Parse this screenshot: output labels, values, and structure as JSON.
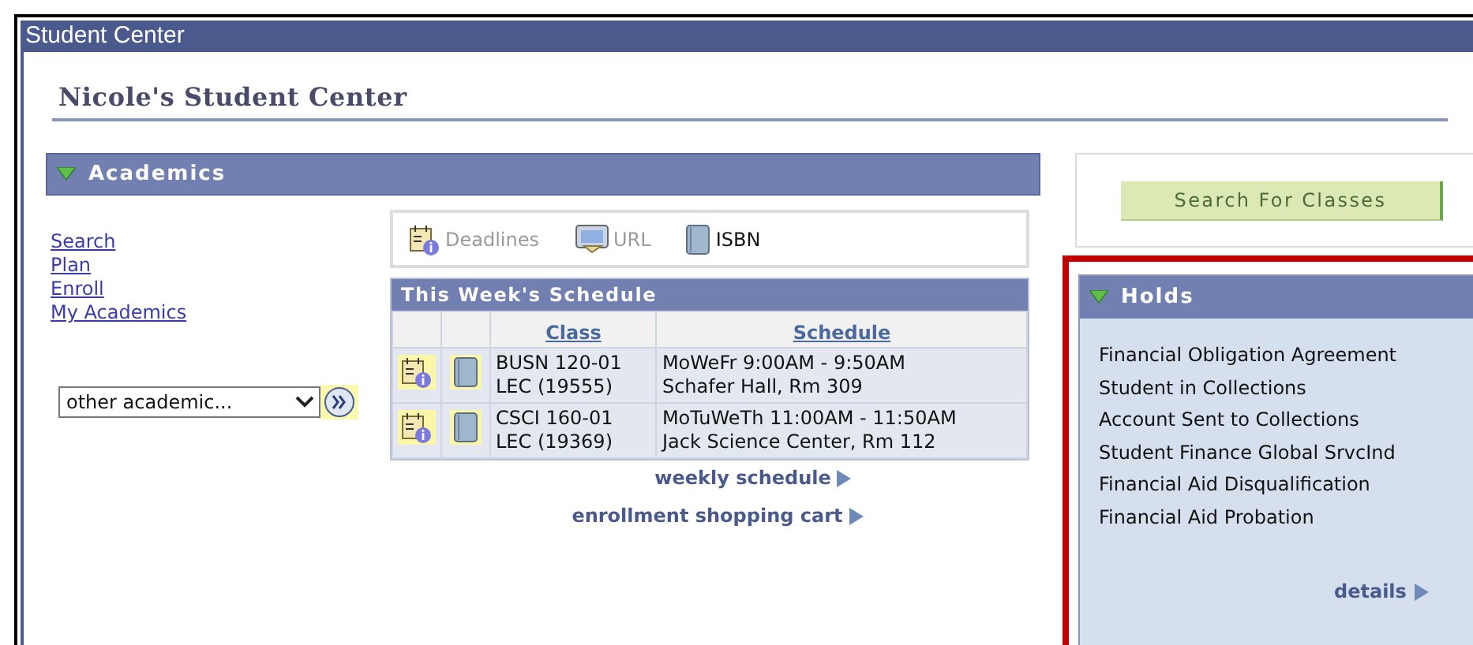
{
  "window": {
    "title": "Student Center"
  },
  "page_title": "Nicole's Student Center",
  "academics": {
    "title": "Academics",
    "expanded": true,
    "links": [
      "Search",
      "Plan",
      "Enroll",
      "My Academics"
    ],
    "dropdown": {
      "value": "other academic..."
    },
    "toolbar": [
      {
        "kind": "deadlines",
        "label": "Deadlines",
        "disabled": true
      },
      {
        "kind": "url",
        "label": "URL",
        "disabled": true
      },
      {
        "kind": "book",
        "label": "ISBN",
        "disabled": false
      }
    ],
    "schedule": {
      "title": "This Week's Schedule",
      "columns": [
        "Class",
        "Schedule"
      ],
      "rows": [
        {
          "class": "BUSN 120-01\nLEC (19555)",
          "schedule": "MoWeFr 9:00AM - 9:50AM\nSchafer Hall, Rm 309"
        },
        {
          "class": "CSCI 160-01\nLEC (19369)",
          "schedule": "MoTuWeTh 11:00AM - 11:50AM\nJack Science Center, Rm 112"
        }
      ]
    },
    "links_below": [
      "weekly schedule",
      "enrollment shopping cart"
    ]
  },
  "search_button": "Search For Classes",
  "holds": {
    "title": "Holds",
    "expanded": true,
    "highlighted": true,
    "items": [
      "Financial Obligation Agreement",
      "Student in Collections",
      "Account Sent to Collections",
      "Student Finance Global SrvcInd",
      "Financial Aid Disqualification",
      "Financial Aid Probation"
    ],
    "details_link": "details"
  }
}
